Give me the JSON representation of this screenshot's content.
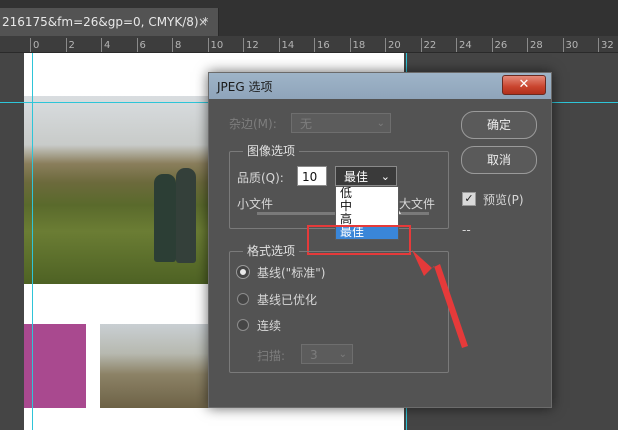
{
  "document": {
    "tab_title": "216175&fm=26&gp=0, CMYK/8) *",
    "tab_close": "×"
  },
  "ruler": {
    "ticks": [
      "0",
      "2",
      "4",
      "6",
      "8",
      "10",
      "12",
      "14",
      "16",
      "18",
      "20",
      "22",
      "24",
      "26",
      "28",
      "30",
      "32"
    ]
  },
  "dialog": {
    "title": "JPEG 选项",
    "close_glyph": "✕",
    "matte": {
      "label": "杂边(M):",
      "value": "无",
      "chevron": "⌄"
    },
    "image_options": {
      "title": "图像选项",
      "quality_label": "品质(Q):",
      "quality_value": "10",
      "quality_selected": "最佳",
      "quality_chevron": "⌄",
      "quality_options": [
        "低",
        "中",
        "高",
        "最佳"
      ],
      "small_file_label": "小文件",
      "large_file_label": "大文件"
    },
    "format_options": {
      "title": "格式选项",
      "radios": [
        {
          "label": "基线(\"标准\")",
          "checked": true
        },
        {
          "label": "基线已优化",
          "checked": false
        },
        {
          "label": "连续",
          "checked": false
        }
      ],
      "scans_label": "扫描:",
      "scans_value": "3",
      "scans_chevron": "⌄"
    },
    "buttons": {
      "ok": "确定",
      "cancel": "取消"
    },
    "preview": {
      "label": "预览(P)",
      "checked": true,
      "check_glyph": "✓"
    },
    "size_readout": "--"
  },
  "colors": {
    "guide": "#2ec5d8",
    "annotation": "#e53a3a",
    "selection": "#3a86d8"
  }
}
